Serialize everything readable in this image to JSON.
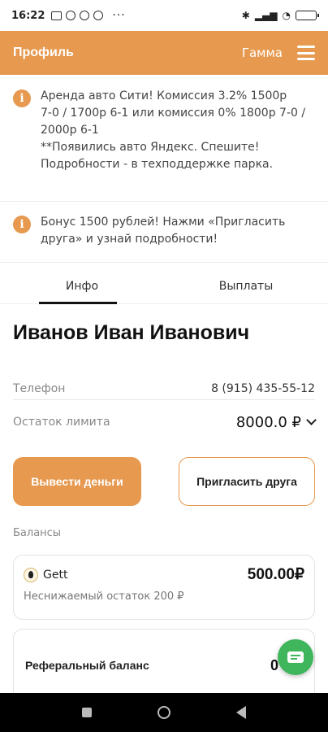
{
  "status_bar": {
    "time": "16:22",
    "battery_level": 1.0
  },
  "header": {
    "title": "Профиль",
    "park": "Гамма"
  },
  "notices": [
    {
      "text": "Аренда авто Сити! Комиссия 3.2% 1500р\n7-0 / 1700р 6-1 или комиссия 0% 1800р 7-0 /\n2000р 6-1\n**Появились авто Яндекс. Спешите!\nПодробности - в техподдержке парка."
    },
    {
      "text": "Бонус 1500 рублей! Нажми «Пригласить\nдруга» и узнай подробности!"
    }
  ],
  "tabs": [
    {
      "label": "Инфо",
      "active": true
    },
    {
      "label": "Выплаты",
      "active": false
    }
  ],
  "profile": {
    "name": "Иванов Иван Иванович",
    "phone_label": "Телефон",
    "phone": "8 (915) 435-55-12",
    "limit_label": "Остаток лимита",
    "limit": "8000.0 ₽"
  },
  "buttons": {
    "withdraw": "Вывести деньги",
    "invite": "Пригласить друга"
  },
  "balances": {
    "section_label": "Балансы",
    "gett": {
      "provider": "Gett",
      "amount": "500.00₽",
      "note": "Неснижаемый остаток 200 ₽"
    },
    "referral": {
      "label": "Реферальный баланс",
      "amount": "0"
    }
  },
  "colors": {
    "accent": "#e6994f",
    "fab": "#3fb65b"
  }
}
